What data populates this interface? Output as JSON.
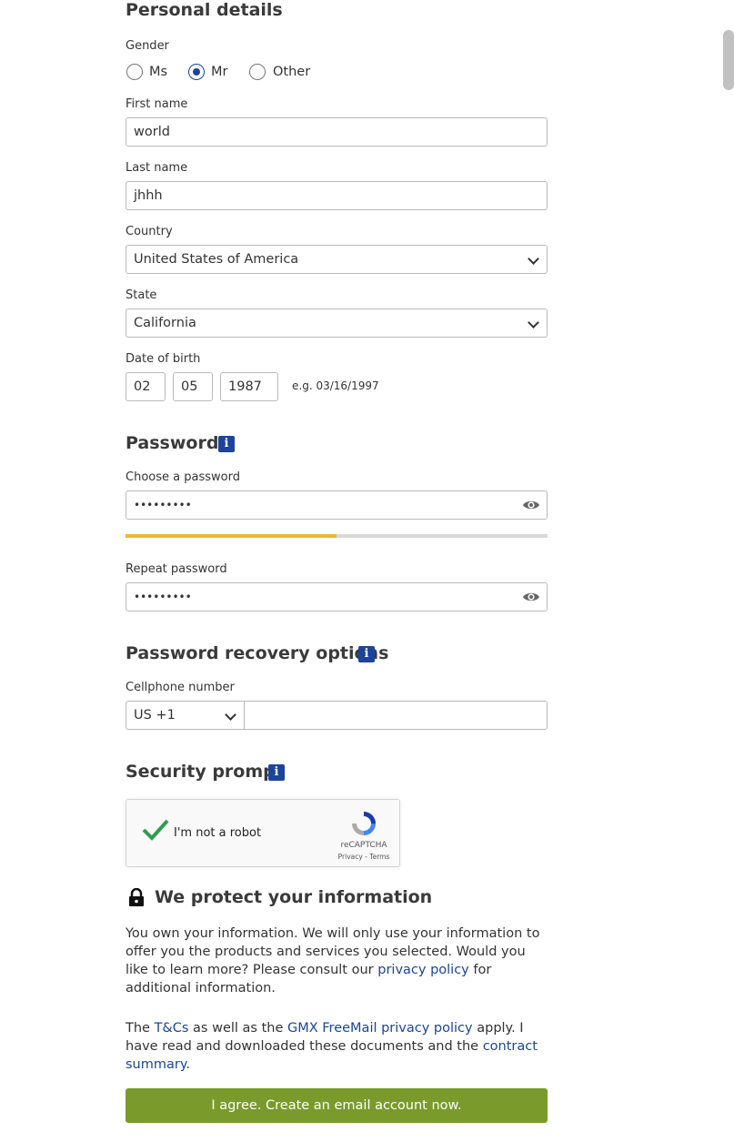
{
  "personal": {
    "heading": "Personal details",
    "gender_label": "Gender",
    "gender_options": [
      "Ms",
      "Mr",
      "Other"
    ],
    "gender_selected": "Mr",
    "first_name_label": "First name",
    "first_name_value": "world",
    "last_name_label": "Last name",
    "last_name_value": "jhhh",
    "country_label": "Country",
    "country_value": "United States of America",
    "state_label": "State",
    "state_value": "California",
    "dob_label": "Date of birth",
    "dob_month": "02",
    "dob_day": "05",
    "dob_year": "1987",
    "dob_hint": "e.g. 03/16/1997"
  },
  "password": {
    "heading": "Password",
    "choose_label": "Choose a password",
    "choose_value": "•••••••••",
    "strength_fraction": 0.5,
    "strength_color": "#e8b935",
    "repeat_label": "Repeat password",
    "repeat_value": "•••••••••"
  },
  "recovery": {
    "heading": "Password recovery options",
    "cell_label": "Cellphone number",
    "country_code": "US +1",
    "cell_value": ""
  },
  "security": {
    "heading": "Security prompt",
    "captcha_text": "I'm not a robot",
    "captcha_brand": "reCAPTCHA",
    "captcha_links": "Privacy - Terms"
  },
  "protect": {
    "heading": "We protect your information",
    "para1_before": "You own your information. We will only use your information to offer you the products and services you selected. Would you like to learn more? Please consult our ",
    "para1_link": "privacy policy",
    "para1_after": " for additional information.",
    "para2_t1": "The ",
    "para2_link1": "T&Cs",
    "para2_t2": " as well as the ",
    "para2_link2": "GMX FreeMail privacy policy",
    "para2_t3": " apply. I have read and downloaded these documents and the ",
    "para2_link3": "contract summary",
    "para2_t4": "."
  },
  "submit_label": "I agree. Create an email account now.",
  "icons": {
    "info": "info-icon",
    "eye": "eye-icon",
    "lock": "lock-icon",
    "checkmark": "checkmark-icon",
    "recaptcha": "recaptcha-logo-icon"
  },
  "colors": {
    "accent": "#1c449b",
    "button": "#7a9a2b",
    "captcha_check": "#2e9e4c"
  }
}
